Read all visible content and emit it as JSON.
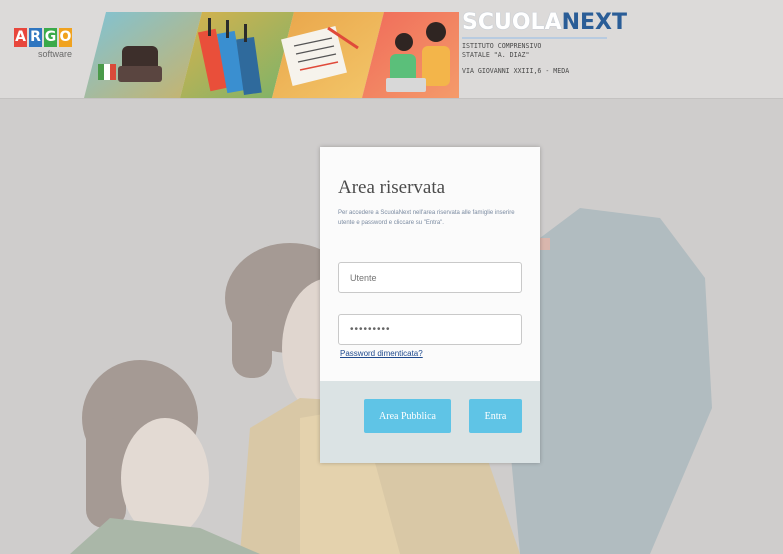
{
  "header": {
    "logo": {
      "letters": [
        "A",
        "R",
        "G",
        "O"
      ],
      "letter_colors": [
        "#e8463c",
        "#2f76c0",
        "#3aaa4a",
        "#f0a21f"
      ],
      "subtitle": "software"
    },
    "brand": {
      "part1": "SCUOLA",
      "part2": "NEXT"
    },
    "school_name": "ISTITUTO COMPRENSIVO STATALE \"A. DIAZ\"",
    "school_address": "VIA GIOVANNI XXIII,6 - MEDA"
  },
  "login": {
    "title": "Area riservata",
    "description": "Per accedere a ScuolaNext nell'area riservata alle famiglie inserire utente e password e cliccare su \"Entra\".",
    "username": {
      "placeholder": "Utente",
      "value": ""
    },
    "password": {
      "value": "•••••••••"
    },
    "forgot_label": "Password dimenticata?",
    "public_area_label": "Area Pubblica",
    "enter_label": "Entra"
  },
  "colors": {
    "accent_button": "#5fc4e6",
    "background": "#cfcdcc",
    "card_footer": "#dbe3e4",
    "link": "#1f4a8e"
  }
}
